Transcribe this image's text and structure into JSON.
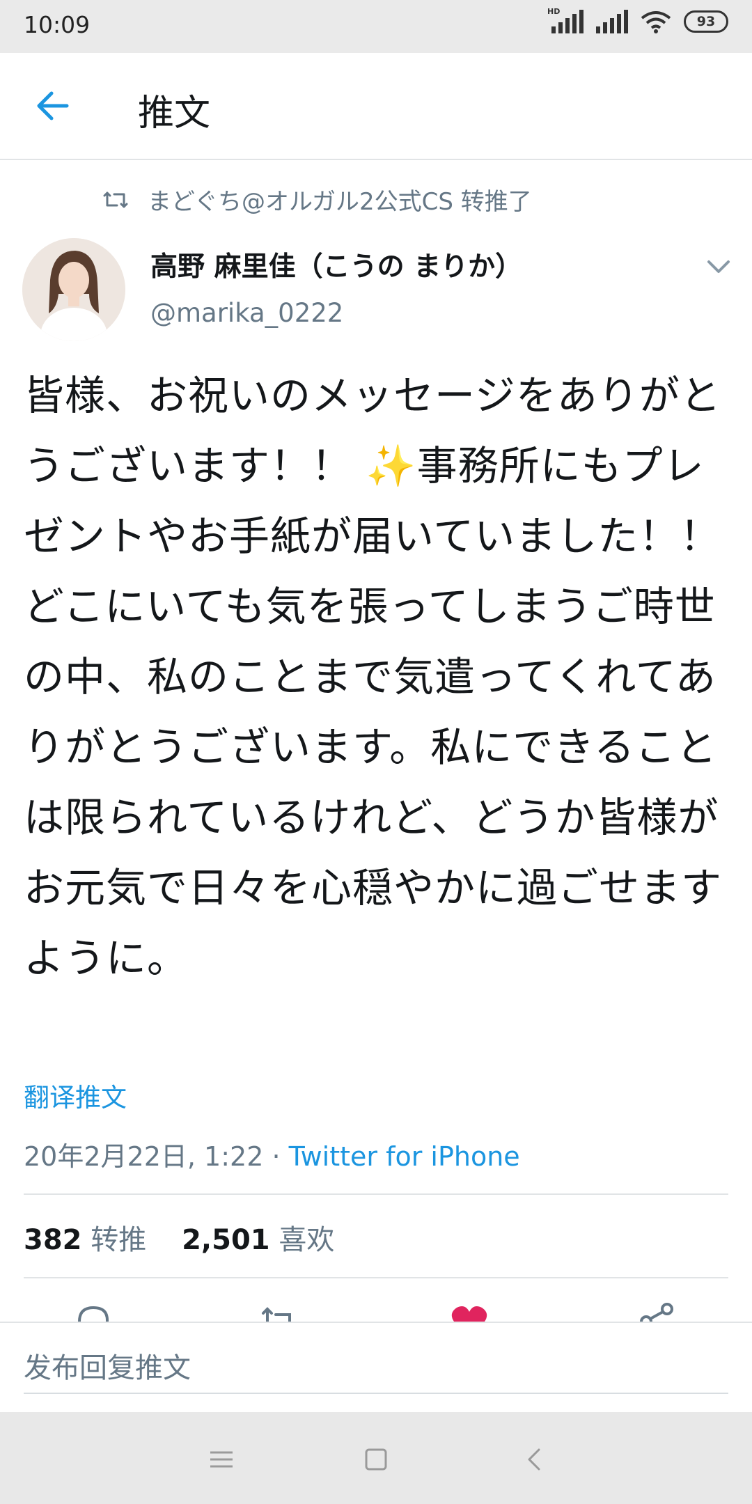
{
  "status_bar": {
    "time": "10:09",
    "network_label": "HD",
    "battery": "93"
  },
  "header": {
    "title": "推文",
    "back_icon": "arrow-left-icon"
  },
  "retweet_context": {
    "text": "まどぐち@オルガル2公式CS 转推了"
  },
  "tweet": {
    "author_name": "高野 麻里佳（こうの まりか）",
    "author_handle": "@marika_0222",
    "text": "皆様、お祝いのメッセージをありがとうございます！！ ✨事務所にもプレゼントやお手紙が届いていました！！\nどこにいても気を張ってしまうご時世の中、私のことまで気遣ってくれてありがとうございます。私にできることは限られているけれど、どうか皆様がお元気で日々を心穏やかに過ごせますように。",
    "translate_label": "翻译推文",
    "timestamp": "20年2月22日, 1:22",
    "separator": " · ",
    "source": "Twitter for iPhone"
  },
  "stats": {
    "retweets_count": "382",
    "retweets_label": "转推",
    "likes_count": "2,501",
    "likes_label": "喜欢"
  },
  "reply": {
    "placeholder": "发布回复推文"
  },
  "colors": {
    "accent": "#1b95e0",
    "like": "#e0245e",
    "muted": "#657786"
  }
}
